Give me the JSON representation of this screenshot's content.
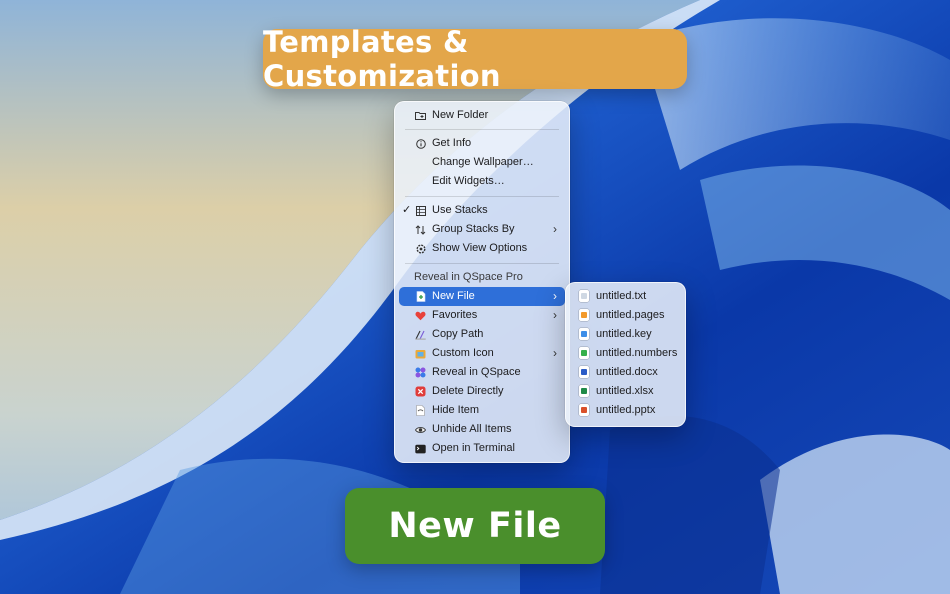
{
  "banners": {
    "top": "Templates & Customization",
    "bottom": "New File"
  },
  "context_menu": {
    "items": [
      {
        "label": "New Folder",
        "icon": "new-folder-icon"
      },
      {
        "label": "Get Info",
        "icon": "info-icon"
      },
      {
        "label": "Change Wallpaper…",
        "icon": ""
      },
      {
        "label": "Edit Widgets…",
        "icon": ""
      },
      {
        "label": "Use Stacks",
        "icon": "stacks-icon",
        "checked": true
      },
      {
        "label": "Group Stacks By",
        "icon": "sort-arrows-icon",
        "submenu": true
      },
      {
        "label": "Show View Options",
        "icon": "view-options-icon"
      },
      {
        "label": "Reveal in QSpace Pro",
        "icon": "",
        "header": true
      },
      {
        "label": "New File",
        "icon": "new-file-icon",
        "submenu": true,
        "highlighted": true
      },
      {
        "label": "Favorites",
        "icon": "heart-icon",
        "submenu": true
      },
      {
        "label": "Copy Path",
        "icon": "copy-path-icon"
      },
      {
        "label": "Custom Icon",
        "icon": "custom-icon-icon",
        "submenu": true
      },
      {
        "label": "Reveal in QSpace",
        "icon": "qspace-icon"
      },
      {
        "label": "Delete Directly",
        "icon": "delete-icon"
      },
      {
        "label": "Hide Item",
        "icon": "hide-icon"
      },
      {
        "label": "Unhide All Items",
        "icon": "eye-icon"
      },
      {
        "label": "Open in Terminal",
        "icon": "terminal-icon"
      }
    ],
    "highlight_color": "#2e6fd9"
  },
  "new_file_submenu": {
    "items": [
      {
        "label": "untitled.txt",
        "icon": "txt-file-icon"
      },
      {
        "label": "untitled.pages",
        "icon": "pages-file-icon"
      },
      {
        "label": "untitled.key",
        "icon": "keynote-file-icon"
      },
      {
        "label": "untitled.numbers",
        "icon": "numbers-file-icon"
      },
      {
        "label": "untitled.docx",
        "icon": "word-file-icon"
      },
      {
        "label": "untitled.xlsx",
        "icon": "excel-file-icon"
      },
      {
        "label": "untitled.pptx",
        "icon": "powerpoint-file-icon"
      }
    ]
  },
  "colors": {
    "top_banner": "#e3a64a",
    "bottom_banner": "#4a8f2c"
  },
  "symbols": {
    "check": "✓",
    "chevron": "›"
  }
}
